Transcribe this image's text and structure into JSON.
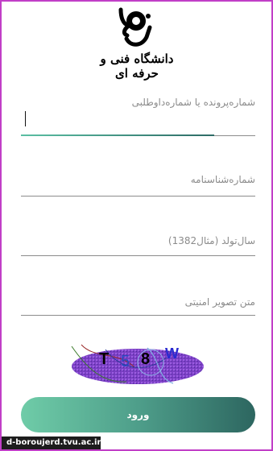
{
  "logo": {
    "text": "دانشگاه فنی و حرفه ای"
  },
  "form": {
    "fields": [
      {
        "label": "شماره‌پرونده یا شماره‌داوطلبی",
        "value": ""
      },
      {
        "label": "شماره‌شناسنامه",
        "value": ""
      },
      {
        "label": "سال‌تولد (مثال1382)",
        "value": ""
      },
      {
        "label": "متن تصویر امنیتی",
        "value": ""
      }
    ],
    "captcha_text": [
      "T",
      "5",
      "8",
      "W"
    ],
    "submit_label": "ورود"
  },
  "footer": {
    "text": "d-boroujerd.tvu.ac.ir"
  },
  "colors": {
    "frame": "#c13fc7",
    "accent_start": "#6fcca8",
    "accent_end": "#2d6660",
    "captcha_fill": "#7b3fc4"
  }
}
